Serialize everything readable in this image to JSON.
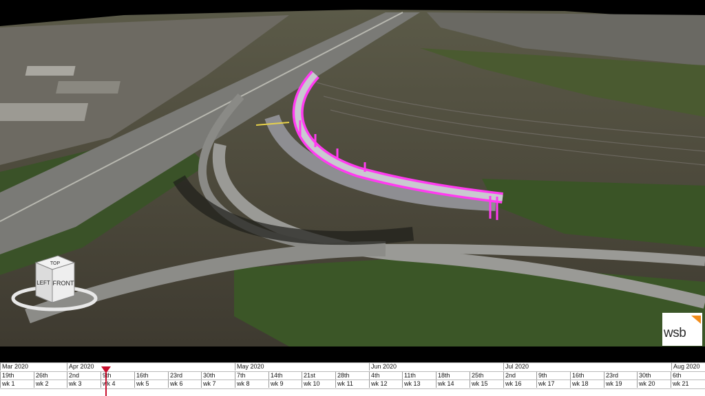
{
  "viewport": {
    "colors": {
      "highlight": "#ff3cf0",
      "grass": "#3f5a2a",
      "road": "#8c8c8c",
      "sky": "#000000"
    }
  },
  "viewcube": {
    "top_label": "TOP",
    "left_label": "LEFT",
    "front_label": "FRONT"
  },
  "logo": {
    "text": "wsb",
    "accent": "#f28c1a"
  },
  "timeline": {
    "months": [
      "Mar 2020",
      "Apr 2020",
      "May 2020",
      "Jun 2020",
      "Jul 2020",
      "Aug 2020"
    ],
    "days": [
      "19th",
      "26th",
      "2nd",
      "9th",
      "16th",
      "23rd",
      "30th",
      "7th",
      "14th",
      "21st",
      "28th",
      "4th",
      "11th",
      "18th",
      "25th",
      "2nd",
      "9th",
      "16th",
      "23rd",
      "30th",
      "6th"
    ],
    "weeks": [
      "wk 1",
      "wk 2",
      "wk 3",
      "wk 4",
      "wk 5",
      "wk 6",
      "wk 7",
      "wk 8",
      "wk 9",
      "wk 10",
      "wk 11",
      "wk 12",
      "wk 13",
      "wk 14",
      "wk 15",
      "wk 16",
      "wk 17",
      "wk 18",
      "wk 19",
      "wk 20",
      "wk 21"
    ],
    "current_week_index": 3,
    "playhead_color": "#c8102e"
  }
}
